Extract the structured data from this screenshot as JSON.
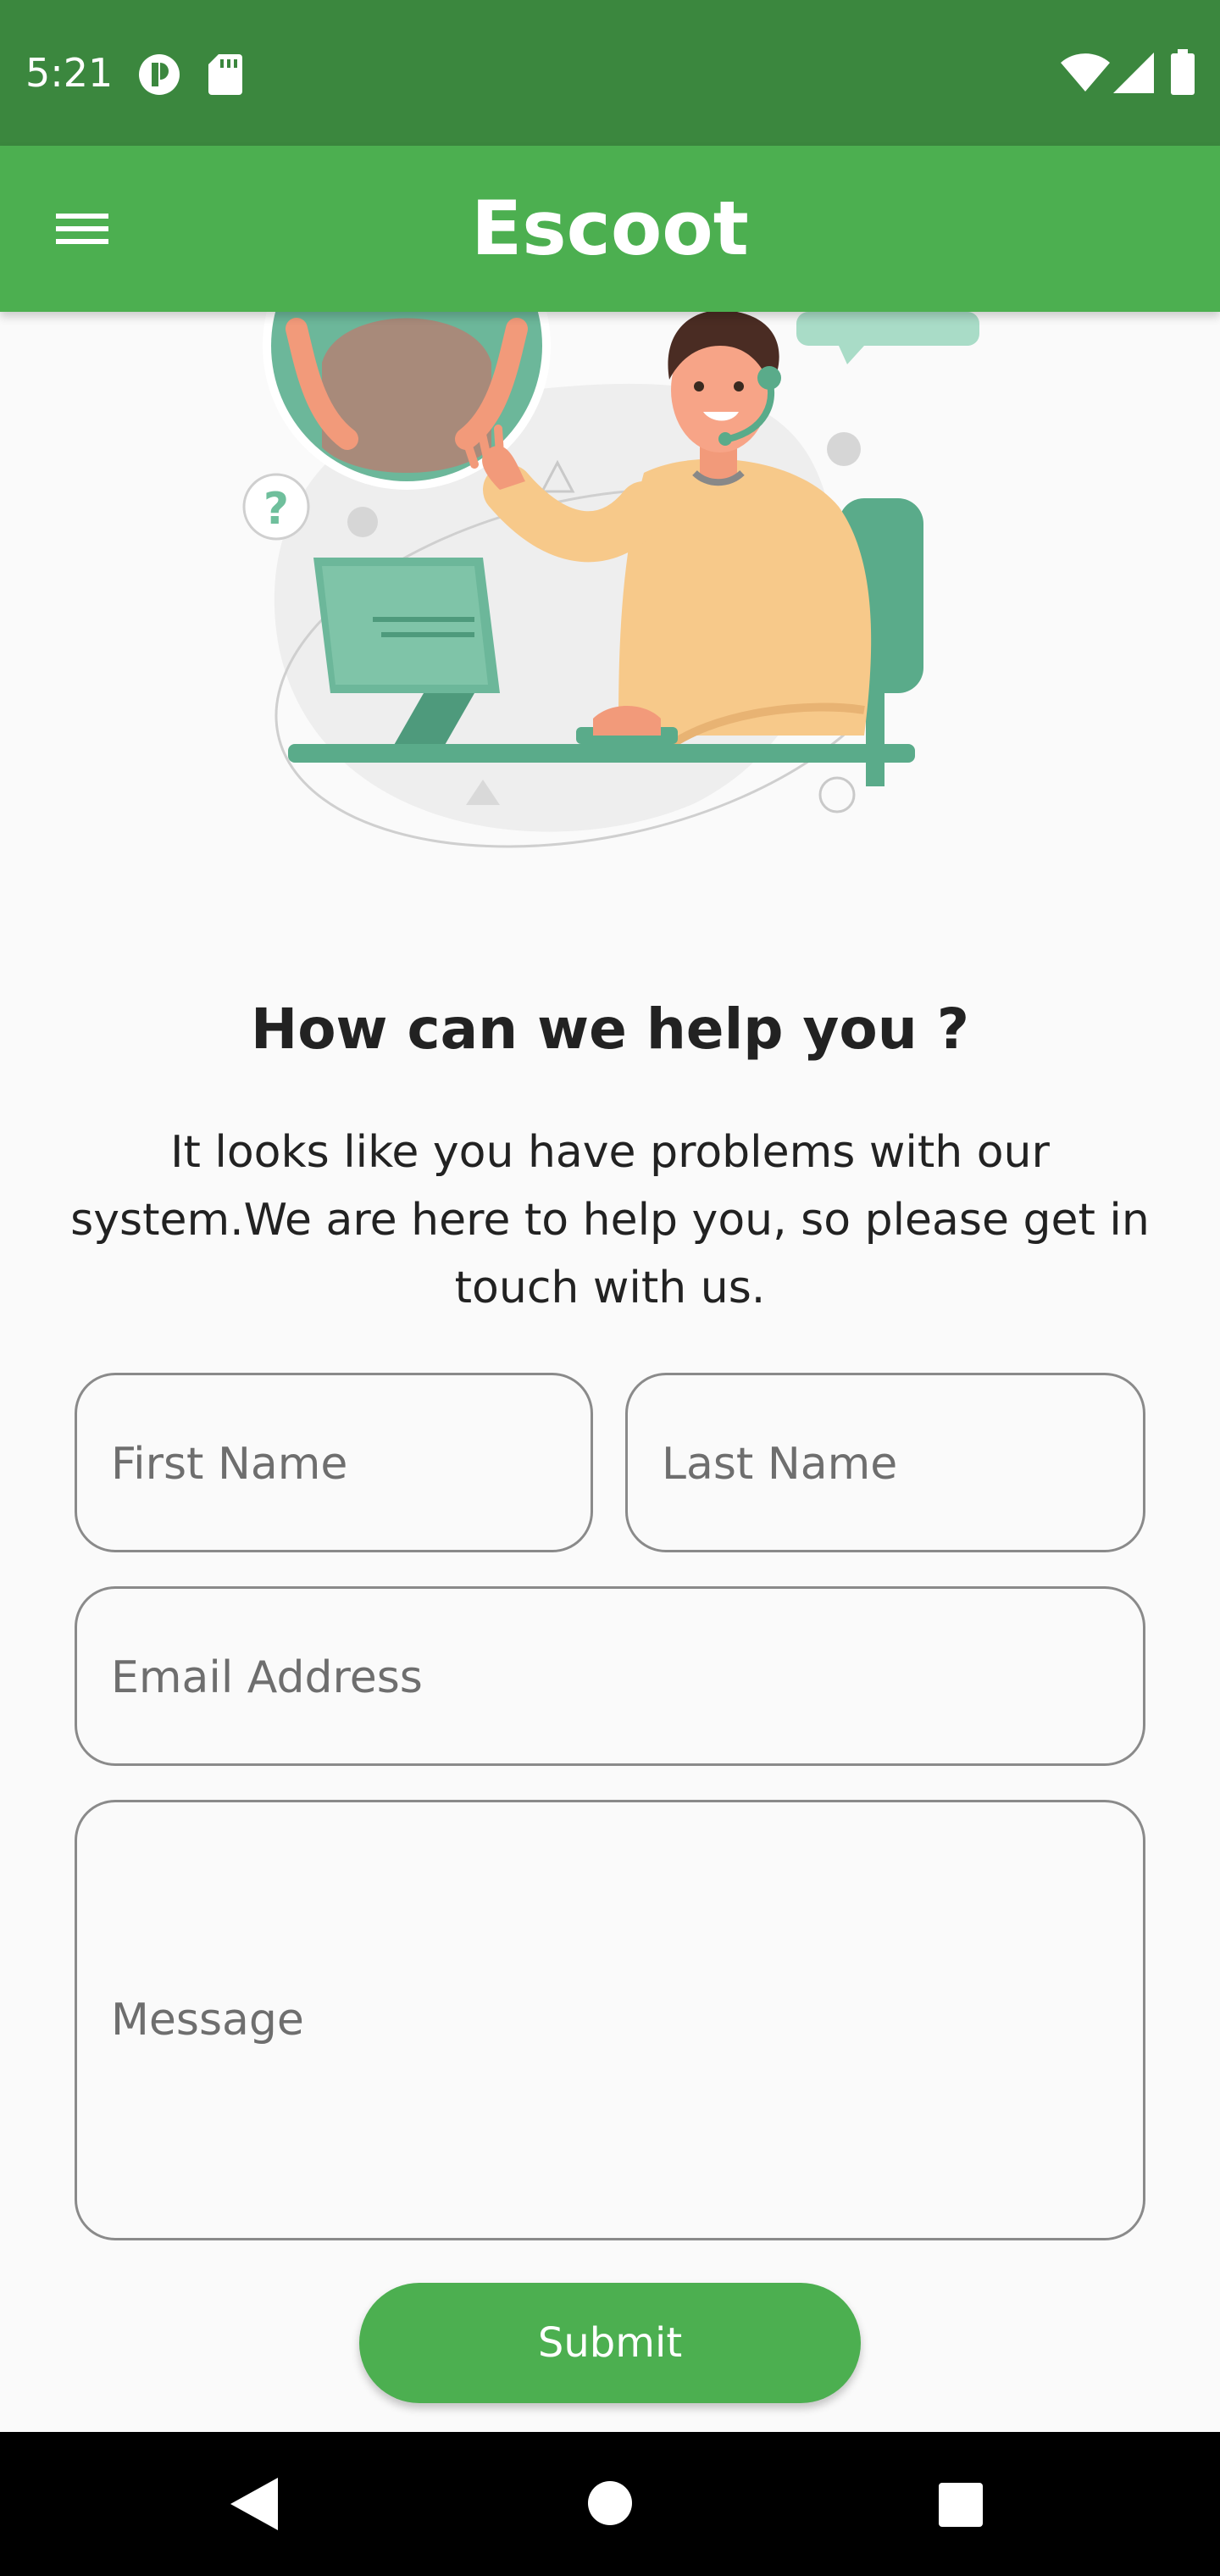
{
  "status_bar": {
    "time": "5:21",
    "icons": [
      "app-notification-icon",
      "sd-card-icon",
      "wifi-icon",
      "signal-icon",
      "battery-icon"
    ]
  },
  "app_bar": {
    "title": "Escoot",
    "menu_icon": "hamburger-menu-icon"
  },
  "content": {
    "heading": "How can we help you ?",
    "description": "It looks like you have problems with our system.We are here to help you, so please get in touch with us."
  },
  "form": {
    "first_name_placeholder": "First Name",
    "last_name_placeholder": "Last Name",
    "email_placeholder": "Email Address",
    "message_placeholder": "Message",
    "submit_label": "Submit"
  },
  "nav_bar": {
    "icons": [
      "back-icon",
      "home-icon",
      "recents-icon"
    ]
  },
  "colors": {
    "status_bar": "#3b873e",
    "app_bar": "#4caf50",
    "accent": "#4caf50",
    "background": "#fafafa"
  }
}
